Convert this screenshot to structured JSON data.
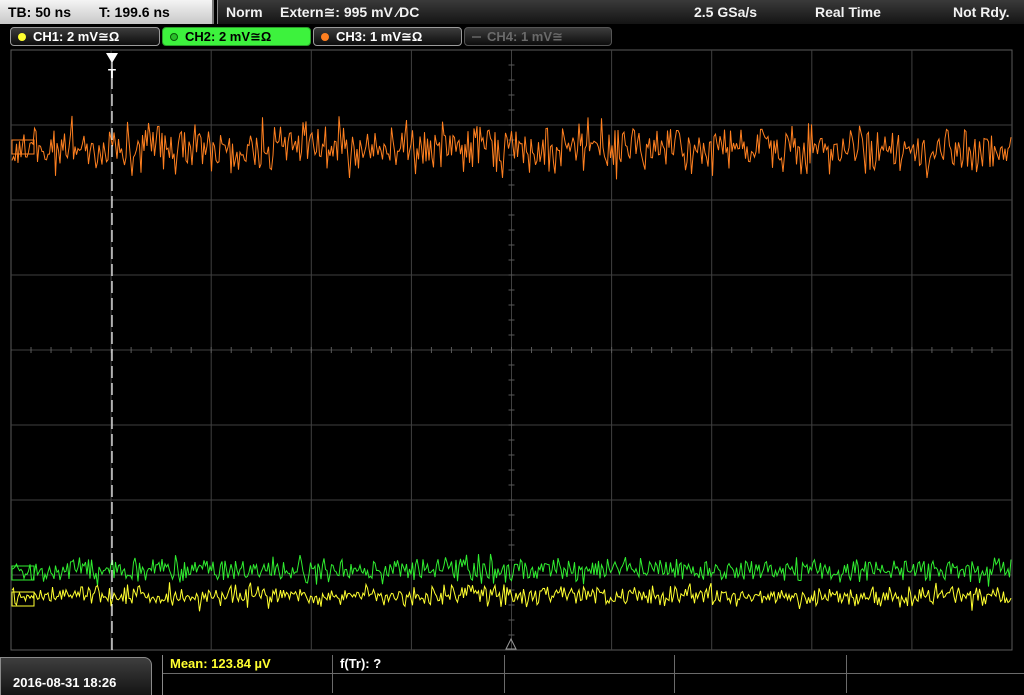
{
  "top_bar": {
    "timebase": "TB: 50 ns",
    "trigger_time": "T: 199.6 ns",
    "trigger_mode": "Norm",
    "trigger_source": "Extern≅: 995 mV ⁄DC",
    "sample_rate": "2.5 GSa/s",
    "acquisition": "Real Time",
    "ready_status": "Not Rdy."
  },
  "channels": [
    {
      "label": "CH1: 2 mV≅Ω",
      "color": "#ffff30",
      "active": true
    },
    {
      "label": "CH2: 2 mV≅Ω",
      "color": "#3df23d",
      "active": true,
      "selected": true
    },
    {
      "label": "CH3: 1 mV≅Ω",
      "color": "#ff8020",
      "active": true
    },
    {
      "label": "CH4: 1 mV≅",
      "color": "#555555",
      "active": false
    }
  ],
  "grid": {
    "h_divisions": 10,
    "v_divisions": 8,
    "color": "#404040"
  },
  "trigger_marker": {
    "label": "T"
  },
  "bottom_bar": {
    "datetime": "2016-08-31 18:26",
    "measurement_mean": "Mean: 123.84 µV",
    "measurement_freq": "f(Tr): ?"
  }
}
